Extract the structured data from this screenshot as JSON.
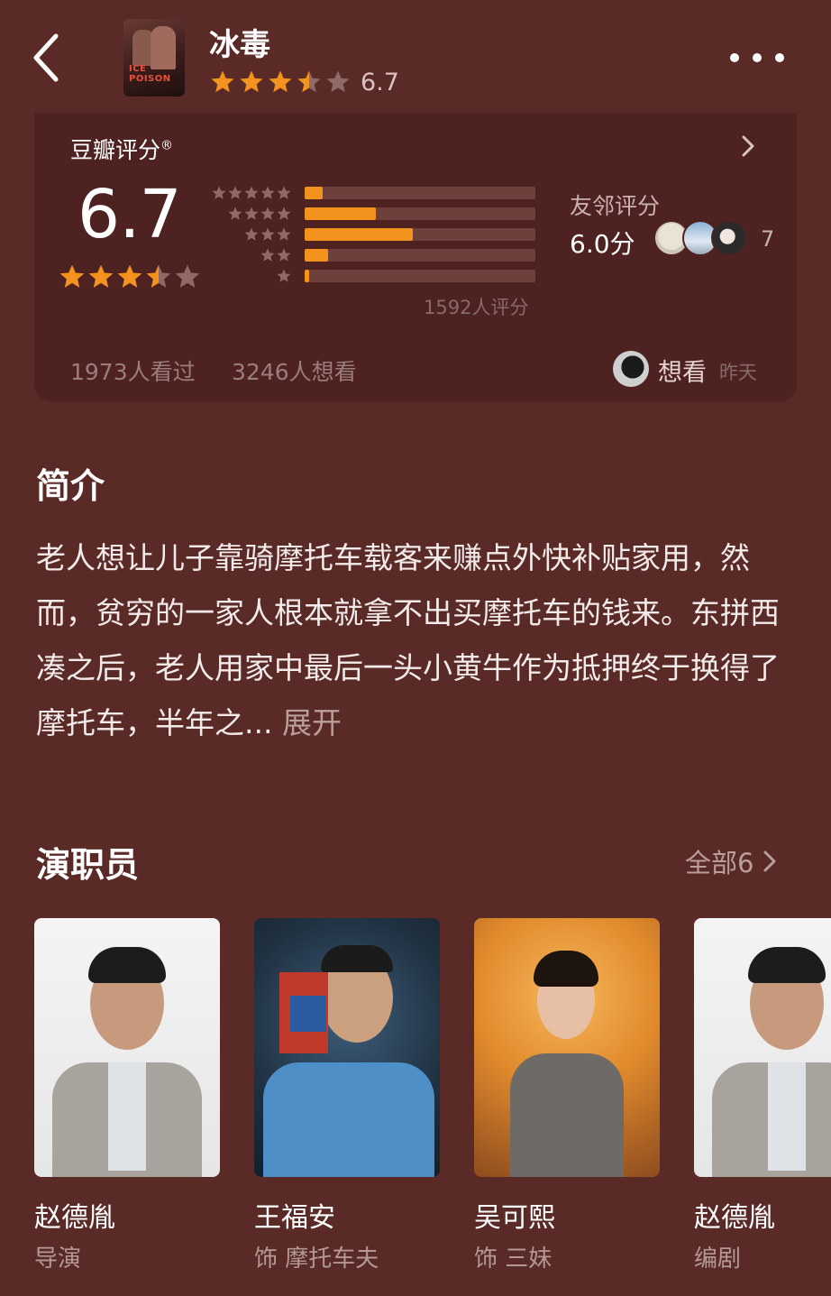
{
  "header": {
    "title": "冰毒",
    "score": "6.7",
    "stars": 3.5,
    "poster_text": "ICE POISON"
  },
  "rating": {
    "label": "豆瓣评分",
    "reg_mark": "®",
    "score": "6.7",
    "stars": 3.5,
    "distribution": [
      {
        "stars": 5,
        "fraction": 0.08
      },
      {
        "stars": 4,
        "fraction": 0.31
      },
      {
        "stars": 3,
        "fraction": 0.47
      },
      {
        "stars": 2,
        "fraction": 0.1
      },
      {
        "stars": 1,
        "fraction": 0.02
      }
    ],
    "rating_count": "1592人评分",
    "friend_label": "友邻评分",
    "friend_score": "6.0分",
    "friend_count": "7",
    "seen": "1973人看过",
    "want": "3246人想看",
    "user_action": "想看",
    "user_time": "昨天"
  },
  "intro": {
    "title": "简介",
    "text": "老人想让儿子靠骑摩托车载客来赚点外快补贴家用，然而，贫穷的一家人根本就拿不出买摩托车的钱来。东拼西凑之后，老人用家中最后一头小黄牛作为抵押终于换得了摩托车，半年之...",
    "expand": "展开"
  },
  "cast": {
    "title": "演职员",
    "all_label": "全部6",
    "members": [
      {
        "name": "赵德胤",
        "role": "导演"
      },
      {
        "name": "王福安",
        "role": "饰 摩托车夫"
      },
      {
        "name": "吴可熙",
        "role": "饰 三妹"
      },
      {
        "name": "赵德胤",
        "role": "编剧"
      }
    ]
  },
  "colors": {
    "background": "#5a2a27",
    "card": "#4e2220",
    "accent": "#f4921e",
    "star_empty": "#8f6a66"
  }
}
